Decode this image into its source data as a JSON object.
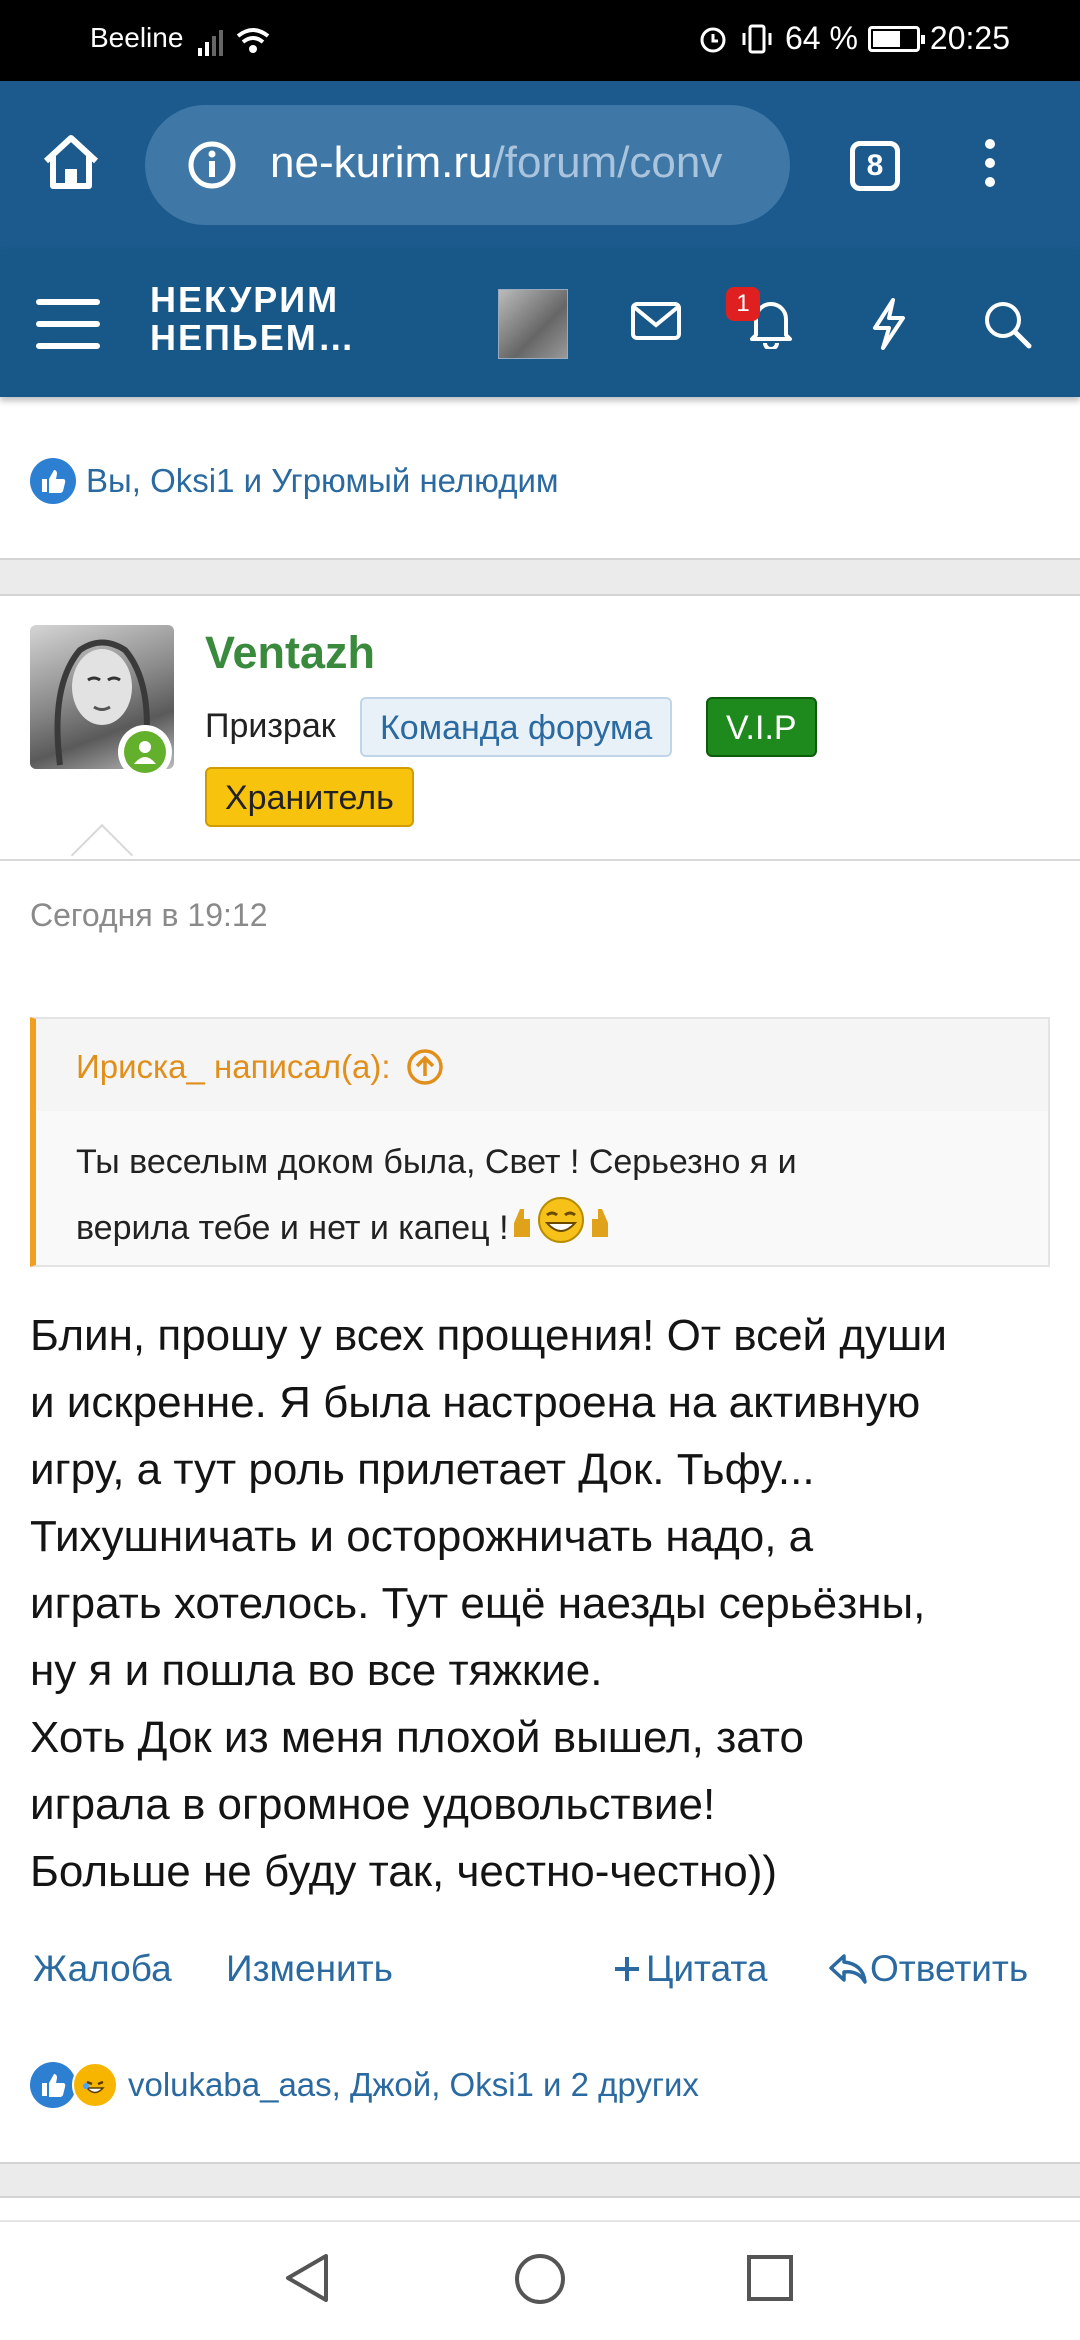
{
  "status_bar": {
    "carrier": "Beeline",
    "battery": "64 %",
    "battery_level": 0.64,
    "time": "20:25"
  },
  "browser": {
    "url_host": "ne-kurim.ru",
    "url_path": "/forum/conv",
    "tab_count": "8"
  },
  "site_header": {
    "logo_line1": "НЕКУРИМ",
    "logo_line2": "НЕПЬЕМ…",
    "notification_count": "1"
  },
  "top_reactions": {
    "text": "Вы, Oksi1 и Угрюмый нелюдим"
  },
  "post": {
    "author": "Ventazh",
    "user_title": "Призрак",
    "badges": {
      "team": "Команда форума",
      "vip": "V.I.P",
      "keeper": "Хранитель"
    },
    "date": "Сегодня в 19:12",
    "quote": {
      "author_line": "Ириска_ написал(а):",
      "line1": "Ты веселым доком была, Свет ! Серьезно я и",
      "line2": "верила тебе и нет и капец !"
    },
    "body_lines": [
      "Блин, прошу у всех прощения! От всей души",
      "и искренне. Я была настроена на активную",
      "игру, а тут роль прилетает Док. Тьфу...",
      "Тихушничать и осторожничать надо, а",
      "играть хотелось. Тут ещё наезды серьёзны,",
      "ну я и пошла во все тяжкие.",
      "Хоть Док из меня плохой вышел, зато",
      "играла в огромное удовольствие!",
      "Больше не буду так, честно-честно))"
    ],
    "actions": {
      "report": "Жалоба",
      "edit": "Изменить",
      "quote": "Цитата",
      "reply": "Ответить"
    },
    "reactions": "volukaba_aas, Джой, Oksi1 и 2 других"
  }
}
